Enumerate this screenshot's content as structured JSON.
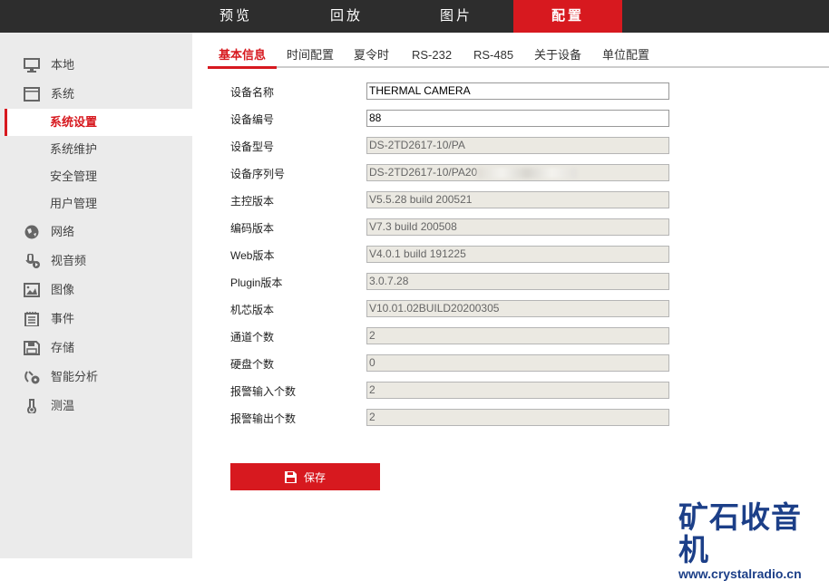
{
  "topnav": [
    "预览",
    "回放",
    "图片",
    "配置"
  ],
  "sidebar": {
    "items": [
      {
        "label": "本地",
        "icon": "monitor-icon"
      },
      {
        "label": "系统",
        "icon": "window-icon"
      }
    ],
    "sub": [
      "系统设置",
      "系统维护",
      "安全管理",
      "用户管理"
    ],
    "more": [
      {
        "label": "网络",
        "icon": "globe-icon"
      },
      {
        "label": "视音频",
        "icon": "microphone-icon"
      },
      {
        "label": "图像",
        "icon": "image-icon"
      },
      {
        "label": "事件",
        "icon": "notepad-icon"
      },
      {
        "label": "存储",
        "icon": "floppy-icon"
      },
      {
        "label": "智能分析",
        "icon": "analytics-icon"
      },
      {
        "label": "测温",
        "icon": "thermometer-icon"
      }
    ]
  },
  "tabs": [
    "基本信息",
    "时间配置",
    "夏令时",
    "RS-232",
    "RS-485",
    "关于设备",
    "单位配置"
  ],
  "fields": [
    {
      "label": "设备名称",
      "value": "THERMAL CAMERA"
    },
    {
      "label": "设备编号",
      "value": "88"
    },
    {
      "label": "设备型号",
      "value": "DS-2TD2617-10/PA"
    },
    {
      "label": "设备序列号",
      "value": "DS-2TD2617-10/PA20"
    },
    {
      "label": "主控版本",
      "value": "V5.5.28 build 200521"
    },
    {
      "label": "编码版本",
      "value": "V7.3 build 200508"
    },
    {
      "label": "Web版本",
      "value": "V4.0.1 build 191225"
    },
    {
      "label": "Plugin版本",
      "value": "3.0.7.28"
    },
    {
      "label": "机芯版本",
      "value": "V10.01.02BUILD20200305"
    },
    {
      "label": "通道个数",
      "value": "2"
    },
    {
      "label": "硬盘个数",
      "value": "0"
    },
    {
      "label": "报警输入个数",
      "value": "2"
    },
    {
      "label": "报警输出个数",
      "value": "2"
    }
  ],
  "save_label": "保存",
  "watermark": {
    "cn": "矿石收音机",
    "url": "www.crystalradio.cn"
  },
  "colors": {
    "accent": "#d7191f",
    "topbar": "#2d2d2d",
    "sidebar": "#ebebeb"
  }
}
